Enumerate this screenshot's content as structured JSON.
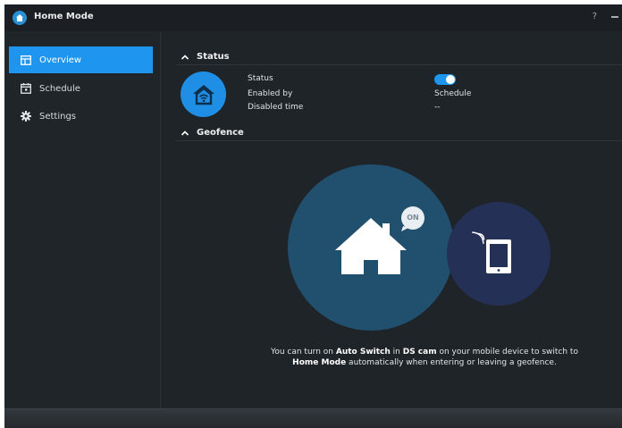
{
  "window": {
    "title": "Home Mode",
    "help_label": "?"
  },
  "sidebar": {
    "items": [
      {
        "label": "Overview",
        "icon": "overview-icon",
        "active": true
      },
      {
        "label": "Schedule",
        "icon": "calendar-icon",
        "active": false
      },
      {
        "label": "Settings",
        "icon": "gear-icon",
        "active": false
      }
    ]
  },
  "status_section": {
    "title": "Status",
    "rows": [
      {
        "label": "Status",
        "value": ""
      },
      {
        "label": "Enabled by",
        "value": "Schedule"
      },
      {
        "label": "Disabled time",
        "value": "--"
      }
    ],
    "toggle_on": true
  },
  "geofence_section": {
    "title": "Geofence",
    "badge": "ON",
    "message": {
      "part1": "You can turn on ",
      "bold1": "Auto Switch",
      "part2": " in ",
      "bold2": "DS cam",
      "part3": " on your mobile device to switch to",
      "bold3": "Home Mode",
      "part4": " automatically when entering or leaving a geofence."
    }
  },
  "colors": {
    "accent": "#1e96f0",
    "background": "#1f2428",
    "geo_home": "#21506e",
    "geo_device": "#243055"
  }
}
